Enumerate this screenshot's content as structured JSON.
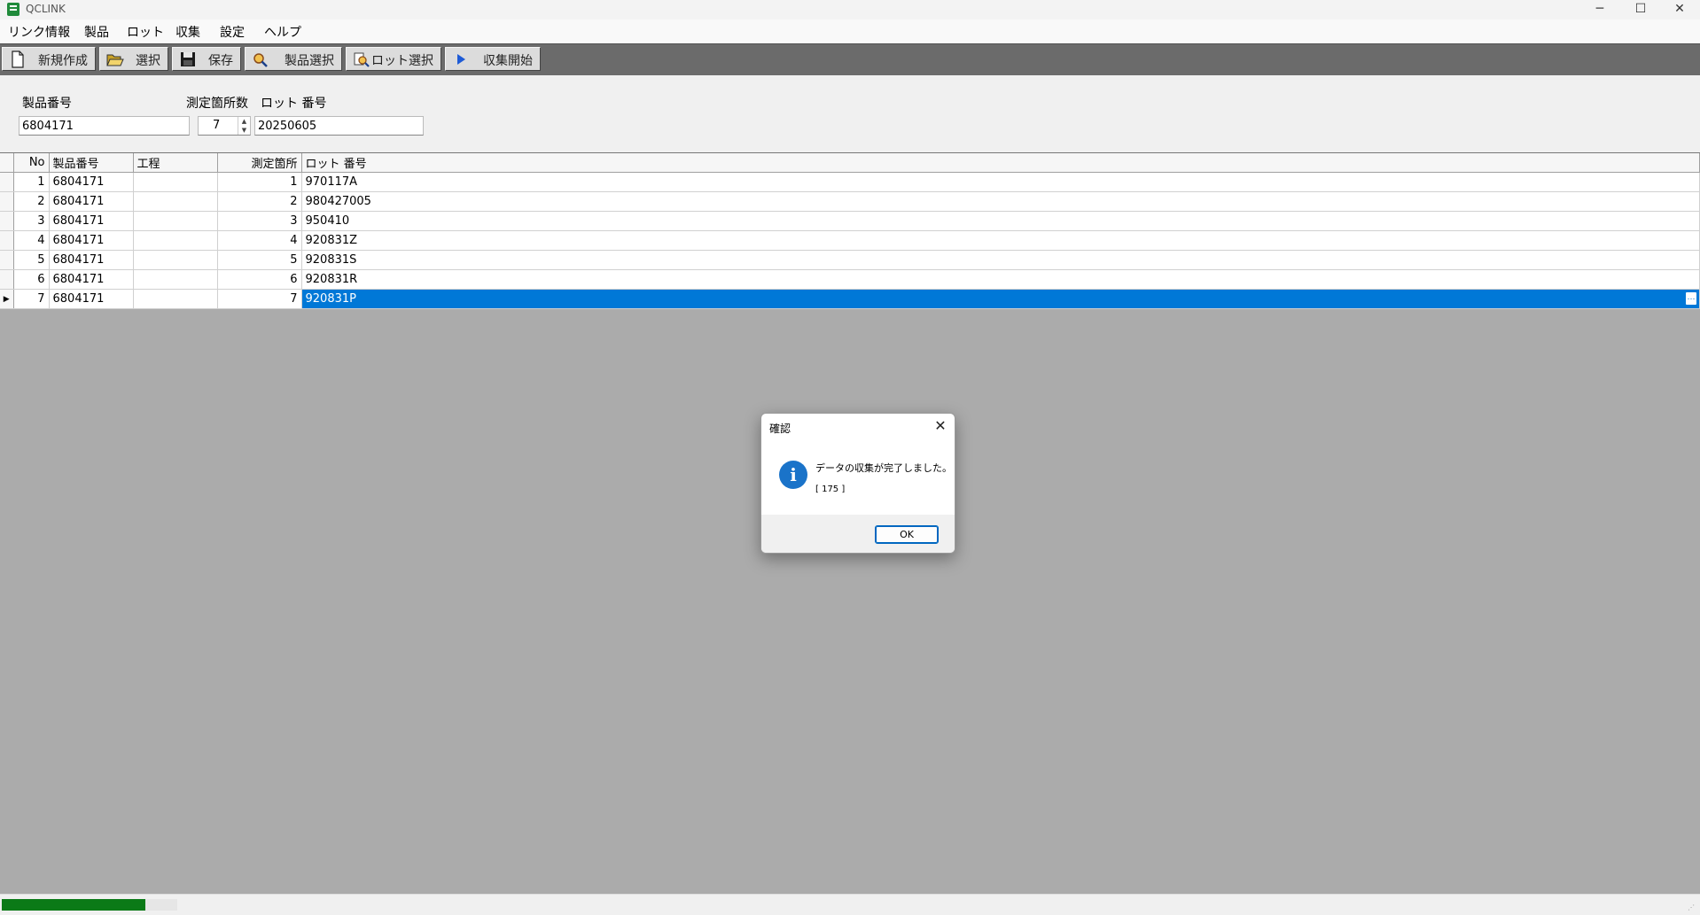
{
  "window": {
    "title": "QCLINK",
    "minimize_glyph": "─",
    "maximize_glyph": "☐",
    "close_glyph": "✕"
  },
  "menu": [
    "リンク情報",
    "製品",
    "ロット",
    "収集",
    "設定",
    "ヘルプ"
  ],
  "toolbar": {
    "new_label": "新規作成",
    "select_label": "選択",
    "save_label": "保存",
    "product_select_label": "製品選択",
    "lot_select_label": "ロット選択",
    "start_collect_label": "収集開始"
  },
  "form": {
    "product_no_label": "製品番号",
    "product_no_value": "6804171",
    "measure_count_label": "測定箇所数",
    "measure_count_value": "7",
    "lot_no_label": "ロット 番号",
    "lot_no_value": "20250605"
  },
  "grid": {
    "columns": [
      "No",
      "製品番号",
      "工程",
      "測定箇所",
      "ロット 番号"
    ],
    "rows": [
      {
        "no": "1",
        "product": "6804171",
        "process": "",
        "point": "1",
        "lot": "970117A"
      },
      {
        "no": "2",
        "product": "6804171",
        "process": "",
        "point": "2",
        "lot": "980427005"
      },
      {
        "no": "3",
        "product": "6804171",
        "process": "",
        "point": "3",
        "lot": "950410"
      },
      {
        "no": "4",
        "product": "6804171",
        "process": "",
        "point": "4",
        "lot": "920831Z"
      },
      {
        "no": "5",
        "product": "6804171",
        "process": "",
        "point": "5",
        "lot": "920831S"
      },
      {
        "no": "6",
        "product": "6804171",
        "process": "",
        "point": "6",
        "lot": "920831R"
      },
      {
        "no": "7",
        "product": "6804171",
        "process": "",
        "point": "7",
        "lot": "920831P"
      }
    ],
    "selected_row": 7,
    "ellipsis_glyph": "…",
    "row_pointer_glyph": "▶"
  },
  "dialog": {
    "title": "確認",
    "message": "データの収集が完了しました。",
    "code": "[ 175 ]",
    "ok_label": "OK",
    "close_glyph": "✕",
    "icon_glyph": "i"
  },
  "status": {
    "progress_fraction": 0.82
  },
  "colors": {
    "selection": "#0078d7",
    "progress": "#0b7a17",
    "toolbar_bg": "#6b6b6b",
    "grid_bg": "#ababab"
  }
}
